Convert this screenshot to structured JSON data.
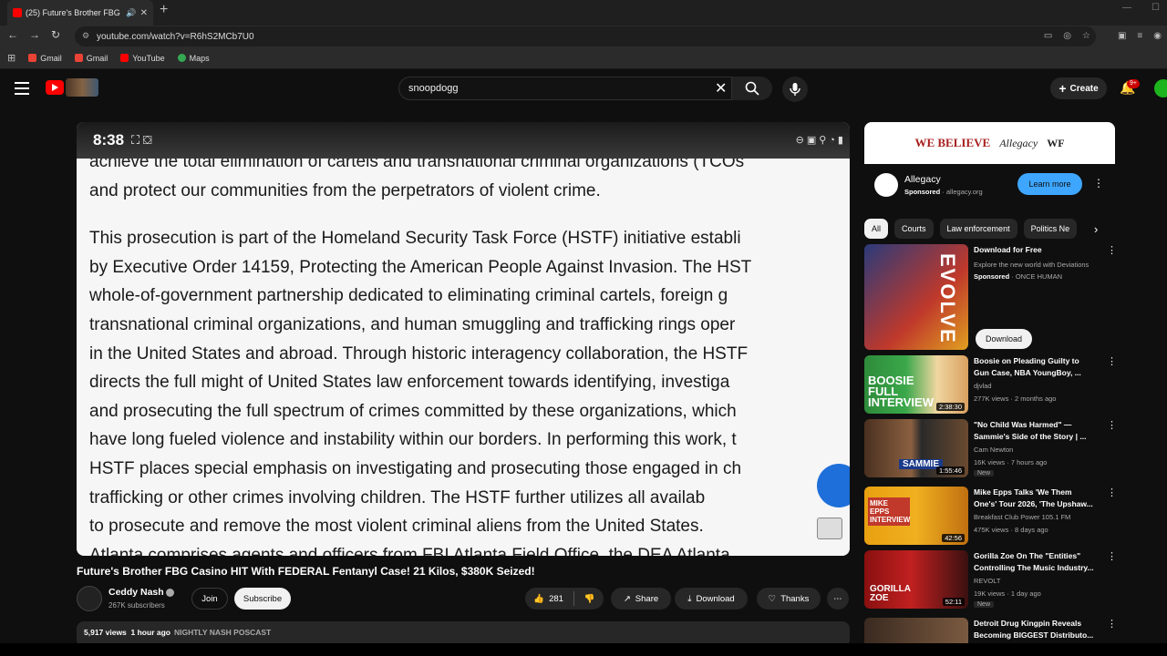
{
  "browser": {
    "tab_title": "(25) Future's Brother FBG C",
    "url": "youtube.com/watch?v=R6hS2MCb7U0",
    "bookmarks": [
      "Gmail",
      "Gmail",
      "YouTube",
      "Maps"
    ]
  },
  "header": {
    "search_value": "snoopdogg",
    "create_label": "Create",
    "notif_badge": "9+"
  },
  "video": {
    "phone_time": "8:38",
    "text_lines": [
      "achieve the total elimination of cartels and transnational criminal organizations (TCOs",
      "and protect our communities from the perpetrators of violent crime.",
      "This prosecution is part of the Homeland Security Task Force (HSTF) initiative establi",
      "by Executive Order 14159, Protecting the American People Against Invasion. The HST",
      "whole-of-government partnership dedicated to eliminating criminal cartels, foreign g",
      "transnational criminal organizations, and human smuggling and trafficking rings oper",
      "in the United States and abroad. Through historic interagency collaboration, the HSTF",
      "directs the full might of United States law enforcement towards identifying, investiga",
      "and prosecuting the full spectrum of crimes committed by these organizations, which",
      "have long fueled violence and instability within our borders. In performing this work, t",
      "HSTF places special emphasis on investigating and prosecuting those engaged in ch",
      "trafficking or other crimes involving children. The HSTF further utilizes all availab",
      "to prosecute and remove the most violent criminal aliens from the United States.",
      "Atlanta comprises agents and officers from FBI Atlanta Field Office, the DEA Atlanta"
    ],
    "title": "Future's Brother FBG Casino HIT With FEDERAL Fentanyl Case! 21 Kilos, $380K Seized!",
    "channel": "Ceddy Nash",
    "subscribers": "267K subscribers",
    "join_label": "Join",
    "subscribe_label": "Subscribe",
    "likes": "281",
    "share_label": "Share",
    "download_label": "Download",
    "thanks_label": "Thanks",
    "views": "5,917 views",
    "age": "1 hour ago",
    "tag": "NIGHTLY NASH POSCAST"
  },
  "ad": {
    "banner_1": "WE BELIEVE",
    "banner_2": "Allegacy",
    "banner_3": "WF",
    "name": "Allegacy",
    "sponsored": "Sponsored",
    "domain": "· allegacy.org",
    "cta": "Learn more"
  },
  "chips": [
    "All",
    "Courts",
    "Law enforcement",
    "Politics Ne"
  ],
  "sponsored_video": {
    "title": "Download for Free",
    "desc": "Explore the new world with Deviations",
    "sponsored": "Sponsored",
    "advertiser": "· ONCE HUMAN",
    "thumb_text": "EVOLVE",
    "cta": "Download"
  },
  "related": [
    {
      "title": "Boosie on Pleading Guilty to Gun Case, NBA YoungBoy, ...",
      "channel": "djvlad",
      "meta": "277K views · 2 months ago",
      "duration": "2:38:30",
      "thumb_text": "BOOSIE FULL INTERVIEW",
      "is_new": ""
    },
    {
      "title": "\"No Child Was Harmed\" — Sammie's Side of the Story | ...",
      "channel": "Cam Newton",
      "meta": "16K views · 7 hours ago",
      "duration": "1:55:46",
      "thumb_text": "SAMMIE",
      "is_new": "New"
    },
    {
      "title": "Mike Epps Talks 'We Them One's' Tour 2026, 'The Upshaw...",
      "channel": "Breakfast Club Power 105.1 FM",
      "meta": "475K views · 8 days ago",
      "duration": "42:56",
      "thumb_text": "MIKE EPPS INTERVIEW",
      "is_new": ""
    },
    {
      "title": "Gorilla Zoe On The \"Entities\" Controlling The Music Industry...",
      "channel": "REVOLT",
      "meta": "19K views · 1 day ago",
      "duration": "52:11",
      "thumb_text": "GORILLA ZOE",
      "is_new": "New"
    },
    {
      "title": "Detroit Drug Kingpin Reveals Becoming BIGGEST Distributo...",
      "channel": "",
      "meta": "",
      "duration": "",
      "thumb_text": "",
      "is_new": ""
    }
  ]
}
